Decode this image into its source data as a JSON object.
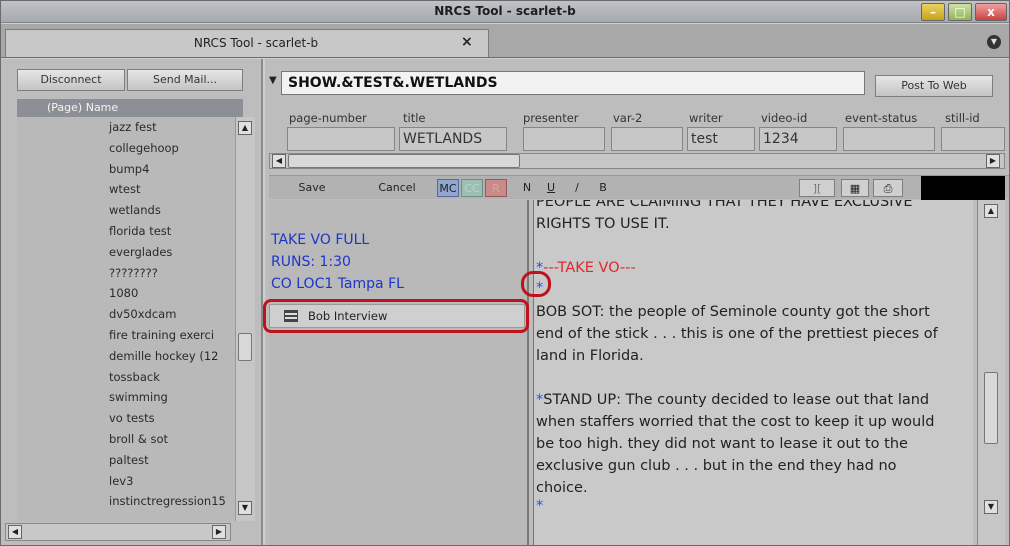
{
  "window": {
    "title": "NRCS Tool - scarlet-b"
  },
  "tab": {
    "label": "NRCS Tool - scarlet-b",
    "close": "×"
  },
  "left": {
    "disconnect": "Disconnect",
    "send_mail": "Send Mail...",
    "list_header": "(Page) Name",
    "items": [
      "jazz fest",
      "collegehoop",
      "bump4",
      "wtest",
      "wetlands",
      "florida test",
      "everglades",
      "????????",
      "1080",
      "dv50xdcam",
      "fire training exerci",
      "demille hockey (12",
      "tossback",
      "swimming",
      "vo tests",
      "broll & sot",
      "paltest",
      "lev3",
      "instinctregression15"
    ]
  },
  "story": {
    "slug": "SHOW.&TEST&.WETLANDS",
    "post_to_web": "Post To Web",
    "fields": [
      {
        "label": "page-number",
        "value": ""
      },
      {
        "label": "title",
        "value": "WETLANDS"
      },
      {
        "label": "presenter",
        "value": ""
      },
      {
        "label": "var-2",
        "value": ""
      },
      {
        "label": "writer",
        "value": "test"
      },
      {
        "label": "video-id",
        "value": "1234"
      },
      {
        "label": "event-status",
        "value": ""
      },
      {
        "label": "still-id",
        "value": ""
      }
    ]
  },
  "toolbar": {
    "save": "Save",
    "cancel": "Cancel",
    "mc": "MC",
    "cc": "CC",
    "rec": "R",
    "n": "N",
    "u": "U",
    "i": "/",
    "b": "B"
  },
  "cues": {
    "line1": "TAKE VO FULL",
    "line2": "RUNS: 1:30",
    "line3": "CO LOC1 Tampa FL",
    "interview": "Bob Interview"
  },
  "script": {
    "top": "PEOPLE ARE CLAIMING THAT THEY HAVE EXCLUSIVE",
    "l1": "RIGHTS TO USE IT.",
    "marker1": "*",
    "take_vo": "---TAKE VO---",
    "marker2": "*",
    "sot1": "BOB SOT: the people of Seminole county got the short",
    "sot2": "end of the stick . . . this is one of the prettiest pieces of",
    "sot3": "land in Florida.",
    "marker3": "*",
    "su1": "STAND UP: The county decided to lease out that land",
    "su2": "when staffers worried that the cost to keep it up would",
    "su3": "be too high. they did not want to lease it out to the",
    "su4": "exclusive gun club . . . but in the end they had no",
    "su5": "choice.",
    "marker4": "*"
  },
  "colors": {
    "annotation": "#c0121c",
    "cue_text": "#1b36c8",
    "red_text": "#e0282c",
    "marker": "#2b4ce0"
  }
}
